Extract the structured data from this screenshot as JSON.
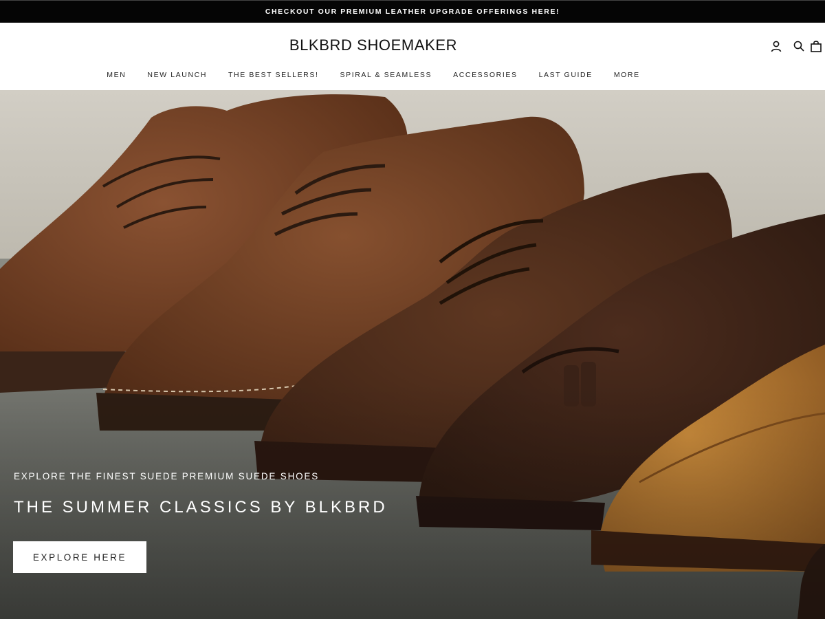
{
  "announcement": {
    "text": "CHECKOUT OUR PREMIUM LEATHER UPGRADE OFFERINGS HERE!"
  },
  "header": {
    "logo": "BLKBRD SHOEMAKER",
    "icons": [
      "account-icon",
      "search-icon",
      "cart-icon"
    ]
  },
  "nav": {
    "items": [
      {
        "label": "MEN"
      },
      {
        "label": "NEW LAUNCH"
      },
      {
        "label": "THE BEST SELLERS!"
      },
      {
        "label": "SPIRAL & SEAMLESS"
      },
      {
        "label": "ACCESSORIES"
      },
      {
        "label": "LAST GUIDE"
      },
      {
        "label": "MORE"
      }
    ]
  },
  "hero": {
    "subtitle": "EXPLORE THE FINEST SUEDE PREMIUM SUEDE SHOES",
    "title": "THE SUMMER CLASSICS BY BLKBRD",
    "button_label": "EXPLORE HERE"
  },
  "colors": {
    "announcement_bg": "#050505",
    "header_bg": "#ffffff",
    "shoe_brown": "#6b3b22",
    "shoe_dark": "#3e2417",
    "shoe_tan": "#b5782f",
    "wall": "#cfcbc2"
  }
}
